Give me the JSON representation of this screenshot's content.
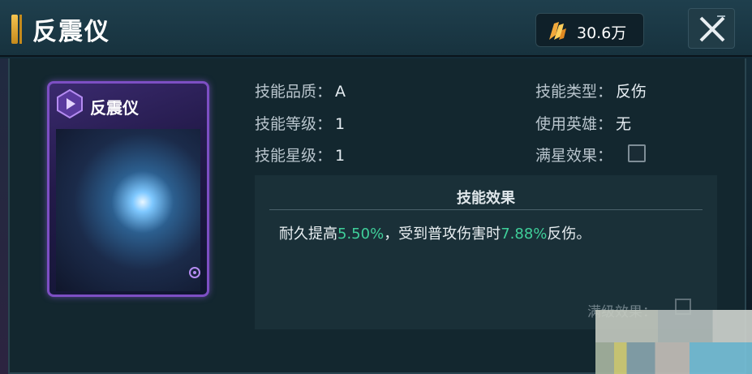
{
  "header": {
    "title": "反震仪",
    "currency_icon": "crystal-icon",
    "currency_value": "30.6万",
    "close_icon": "close-icon"
  },
  "card": {
    "title": "反震仪",
    "badge_icon": "skill-badge-icon",
    "corner_icon": "gear-icon"
  },
  "stats": {
    "quality_label": "技能品质：",
    "quality_value": "A",
    "level_label": "技能等级：",
    "level_value": "1",
    "star_label": "技能星级：",
    "star_value": "1",
    "type_label": "技能类型：",
    "type_value": "反伤",
    "hero_label": "使用英雄：",
    "hero_value": "无",
    "fullstar_label": "满星效果："
  },
  "effect": {
    "title": "技能效果",
    "desc_part1": "耐久提高",
    "desc_value1": "5.50%",
    "desc_part2": "，受到普攻伤害时",
    "desc_value2": "7.88%",
    "desc_part3": "反伤。",
    "max_label": "满级效果："
  },
  "colors": {
    "highlight_green": "#3fcf9a",
    "card_border": "#7d4fc4",
    "accent_gold": "#f5c450"
  }
}
